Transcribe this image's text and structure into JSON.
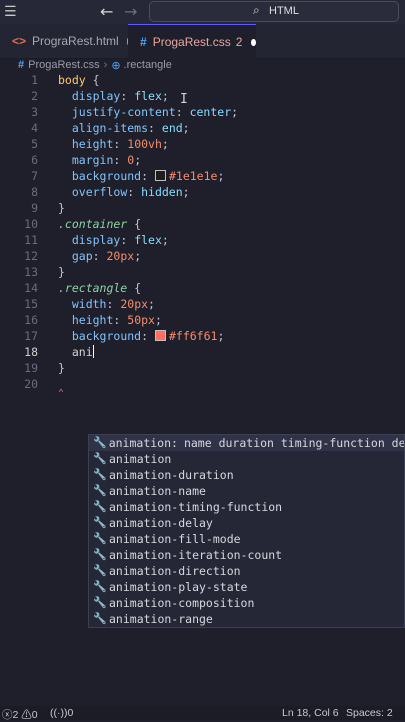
{
  "titlebar": {
    "search_text": "HTML"
  },
  "tabs": [
    {
      "label": "PrograRest.html",
      "count": ""
    },
    {
      "label": "ProgaRest.css",
      "count": "2"
    }
  ],
  "breadcrumb": {
    "file": "ProgaRest.css",
    "symbol": ".rectangle"
  },
  "editor": {
    "line_numbers": [
      "1",
      "2",
      "3",
      "4",
      "5",
      "6",
      "7",
      "8",
      "9",
      "10",
      "11",
      "12",
      "13",
      "14",
      "15",
      "16",
      "17",
      "18",
      "19",
      "20"
    ],
    "code": {
      "l1_sel": "body",
      "l2_prop": "display",
      "l2_val": "flex",
      "l3_prop": "justify-content",
      "l3_val": "center",
      "l4_prop": "align-items",
      "l4_val": "end",
      "l5_prop": "height",
      "l5_val": "100vh",
      "l6_prop": "margin",
      "l6_val": "0",
      "l7_prop": "background",
      "l7_val": "#1e1e1e",
      "l8_prop": "overflow",
      "l8_val": "hidden",
      "l10_sel": ".container",
      "l11_prop": "display",
      "l11_val": "flex",
      "l12_prop": "gap",
      "l12_val": "20px",
      "l14_sel": ".rectangle",
      "l15_prop": "width",
      "l15_val": "20px",
      "l16_prop": "height",
      "l16_val": "50px",
      "l17_prop": "background",
      "l17_val": "#ff6f61",
      "l18_typed": "ani"
    },
    "swatch_colors": {
      "l7": "#1e1e1e",
      "l17": "#ff6f61"
    }
  },
  "suggest": {
    "first_detail": "name duration timing-function delay",
    "items": [
      "animation:",
      "animation",
      "animation-duration",
      "animation-name",
      "animation-timing-function",
      "animation-delay",
      "animation-fill-mode",
      "animation-iteration-count",
      "animation-direction",
      "animation-play-state",
      "animation-composition",
      "animation-range"
    ]
  },
  "status": {
    "errors": "2",
    "warnings": "0",
    "ports": "0",
    "position": "Ln 18, Col 6",
    "spaces": "Spaces: 2"
  }
}
